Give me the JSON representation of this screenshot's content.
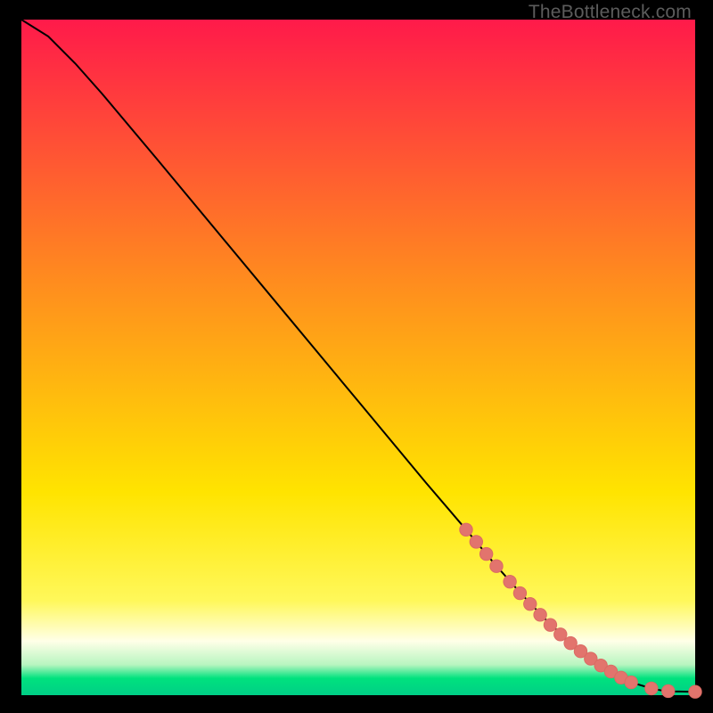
{
  "watermark": "TheBottleneck.com",
  "colors": {
    "line": "#000000",
    "marker_fill": "#e2746d",
    "marker_stroke": "#db6a63",
    "bg_top": "#ff1a4a",
    "bg_mid1": "#ff7a1f",
    "bg_mid2": "#ffe400",
    "bg_white": "#ffffe8",
    "bg_green": "#00e27e"
  },
  "chart_data": {
    "type": "line",
    "title": "",
    "xlabel": "",
    "ylabel": "",
    "xlim": [
      0,
      100
    ],
    "ylim": [
      0,
      100
    ],
    "grid": false,
    "legend": false,
    "series": [
      {
        "name": "curve",
        "x": [
          0,
          4,
          8,
          12,
          20,
          30,
          40,
          50,
          60,
          66,
          70,
          74,
          78,
          82,
          86,
          89,
          91.5,
          93.5,
          95,
          97,
          100
        ],
        "y": [
          100,
          97.5,
          93.5,
          89,
          79.5,
          67.5,
          55.5,
          43.5,
          31.5,
          24.5,
          19.7,
          15.2,
          11,
          7.3,
          4.4,
          2.6,
          1.6,
          1.0,
          0.7,
          0.55,
          0.5
        ]
      }
    ],
    "markers": [
      {
        "x": 66.0,
        "y": 24.5
      },
      {
        "x": 67.5,
        "y": 22.7
      },
      {
        "x": 69.0,
        "y": 20.9
      },
      {
        "x": 70.5,
        "y": 19.1
      },
      {
        "x": 72.5,
        "y": 16.8
      },
      {
        "x": 74.0,
        "y": 15.1
      },
      {
        "x": 75.5,
        "y": 13.5
      },
      {
        "x": 77.0,
        "y": 11.9
      },
      {
        "x": 78.5,
        "y": 10.4
      },
      {
        "x": 80.0,
        "y": 9.0
      },
      {
        "x": 81.5,
        "y": 7.7
      },
      {
        "x": 83.0,
        "y": 6.5
      },
      {
        "x": 84.5,
        "y": 5.4
      },
      {
        "x": 86.0,
        "y": 4.4
      },
      {
        "x": 87.5,
        "y": 3.5
      },
      {
        "x": 89.0,
        "y": 2.6
      },
      {
        "x": 90.5,
        "y": 1.9
      },
      {
        "x": 93.5,
        "y": 1.0
      },
      {
        "x": 96.0,
        "y": 0.6
      },
      {
        "x": 100.0,
        "y": 0.5
      }
    ]
  }
}
